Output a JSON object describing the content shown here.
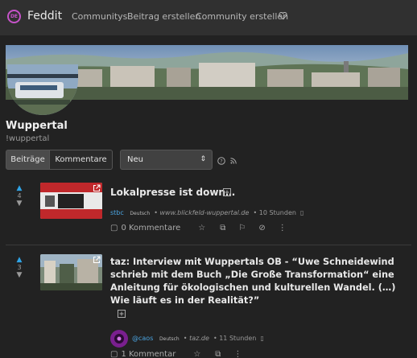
{
  "nav": {
    "brand": "Feddit",
    "logo_text": "DE",
    "links": [
      "Communitys",
      "Beitrag erstellen",
      "Community erstellen"
    ],
    "icon": "heart-icon"
  },
  "community": {
    "title": "Wuppertal",
    "name": "!wuppertal"
  },
  "controls": {
    "tabs": [
      "Beiträge",
      "Kommentare"
    ],
    "sort": "Neu"
  },
  "posts": [
    {
      "score": "4",
      "title": "Lokalpresse ist down…",
      "user": "stbc",
      "language": "Deutsch",
      "domain": "www.blickfeld-wuppertal.de",
      "time": "10 Stunden",
      "comments": "0 Kommentare"
    },
    {
      "score": "3",
      "title": "taz: Interview mit Wuppertals OB - “Uwe Schneidewind schrieb mit dem Buch „Die Große Transformation“ eine Anleitung für ökologischen und kulturellen Wandel. (…) Wie läuft es in der Realität?”",
      "user": "@caos",
      "language": "Deutsch",
      "domain": "taz.de",
      "time": "11 Stunden",
      "comments": "1 Kommentar"
    }
  ],
  "colors": {
    "accent": "#2fa4e7",
    "brand": "#c653c9",
    "background": "#222222"
  }
}
